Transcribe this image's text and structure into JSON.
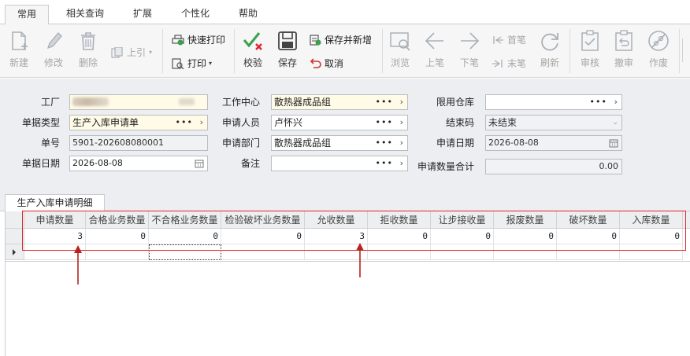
{
  "menu": {
    "tabs": [
      "常用",
      "相关查询",
      "扩展",
      "个性化",
      "帮助"
    ],
    "active": "常用"
  },
  "toolbar": {
    "new": "新建",
    "edit": "修改",
    "delete": "删除",
    "pull": "上引",
    "quick_print": "快速打印",
    "print": "打印",
    "verify": "校验",
    "save": "保存",
    "save_new": "保存并新增",
    "cancel": "取消",
    "browse": "浏览",
    "prev": "上笔",
    "next": "下笔",
    "first": "首笔",
    "last": "末笔",
    "refresh": "刷新",
    "audit": "审核",
    "unaudit": "撤审",
    "void": "作废"
  },
  "form": {
    "factory_label": "工厂",
    "work_center_label": "工作中心",
    "work_center_value": "散热器成品组",
    "limit_wh_label": "限用仓库",
    "limit_wh_value": "",
    "doc_type_label": "单据类型",
    "doc_type_value": "生产入库申请单",
    "applicant_label": "申请人员",
    "applicant_value": "卢怀兴",
    "close_code_label": "结束码",
    "close_code_value": "未结束",
    "doc_no_label": "单号",
    "doc_no_value": "5901-202608080001",
    "dept_label": "申请部门",
    "dept_value": "散热器成品组",
    "apply_date_label": "申请日期",
    "apply_date_value": "2026-08-08",
    "doc_date_label": "单据日期",
    "doc_date_value": "2026-08-08",
    "remark_label": "备注",
    "remark_value": "",
    "total_label": "申请数量合计",
    "total_value": "0.00"
  },
  "grid": {
    "tab": "生产入库申请明细",
    "columns": [
      "申请数量",
      "合格业务数量",
      "不合格业务数量",
      "检验破坏业务数量",
      "允收数量",
      "拒收数量",
      "让步接收量",
      "报废数量",
      "破坏数量",
      "入库数量"
    ],
    "rows": [
      [
        "3",
        "0",
        "0",
        "0",
        "3",
        "0",
        "0",
        "0",
        "0",
        "0"
      ]
    ]
  },
  "colors": {
    "highlight": "#e0252b",
    "required_field": "#fffbe6",
    "form_bg": "#eceef1"
  }
}
